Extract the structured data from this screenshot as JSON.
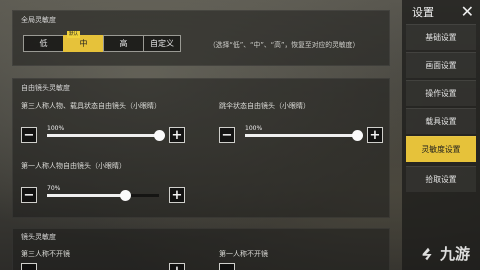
{
  "sensitivity_preset": {
    "title": "全局灵敏度",
    "options": [
      "低",
      "中",
      "高",
      "自定义"
    ],
    "selected": "中",
    "default_badge": "默认",
    "hint": "（选择“低”、“中”、“高”，恢复至对应的灵敏度）"
  },
  "free_camera": {
    "title": "自由镜头灵敏度",
    "sliders": [
      {
        "label": "第三人称人物、载具状态自由镜头（小眼睛）",
        "value": 100,
        "value_text": "100%"
      },
      {
        "label": "跳伞状态自由镜头（小眼睛）",
        "value": 100,
        "value_text": "100%"
      },
      {
        "label": "第一人称人物自由镜头（小眼睛）",
        "value": 70,
        "value_text": "70%"
      }
    ],
    "minus": "−",
    "plus": "+"
  },
  "scope_section": {
    "title": "镜头灵敏度",
    "items": [
      "第三人称不开镜",
      "第一人称不开镜"
    ]
  },
  "sidebar": {
    "title": "设置",
    "close": "✕",
    "items": [
      "基础设置",
      "画面设置",
      "操作设置",
      "载具设置",
      "灵敏度设置",
      "拾取设置"
    ],
    "active": "灵敏度设置"
  },
  "watermark": {
    "text": "九游"
  },
  "colors": {
    "accent": "#e6c23a"
  }
}
